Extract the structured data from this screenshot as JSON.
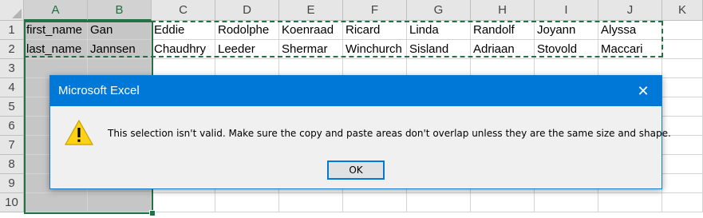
{
  "sheet": {
    "columns": [
      "A",
      "B",
      "C",
      "D",
      "E",
      "F",
      "G",
      "H",
      "I",
      "J",
      "K"
    ],
    "rows": [
      "1",
      "2",
      "3",
      "4",
      "5",
      "6",
      "7",
      "8",
      "9",
      "10"
    ],
    "cells": [
      [
        "first_name",
        "Gan",
        "Eddie",
        "Rodolphe",
        "Koenraad",
        "Ricard",
        "Linda",
        "Randolf",
        "Joyann",
        "Alyssa",
        ""
      ],
      [
        "last_name",
        "Jannsen",
        "Chaudhry",
        "Leeder",
        "Shermar",
        "Winchurch",
        "Sisland",
        "Adriaan",
        "Stovold",
        "Maccari",
        ""
      ]
    ]
  },
  "dialog": {
    "title": "Microsoft Excel",
    "message": "This selection isn't valid. Make sure the copy and paste areas don't overlap unless they are the same size and shape.",
    "ok_label": "OK",
    "close_glyph": "✕",
    "icon": "warning-icon"
  },
  "colors": {
    "excel_green": "#217346",
    "title_bar": "#0078d7",
    "warning_yellow": "#fcd116"
  }
}
